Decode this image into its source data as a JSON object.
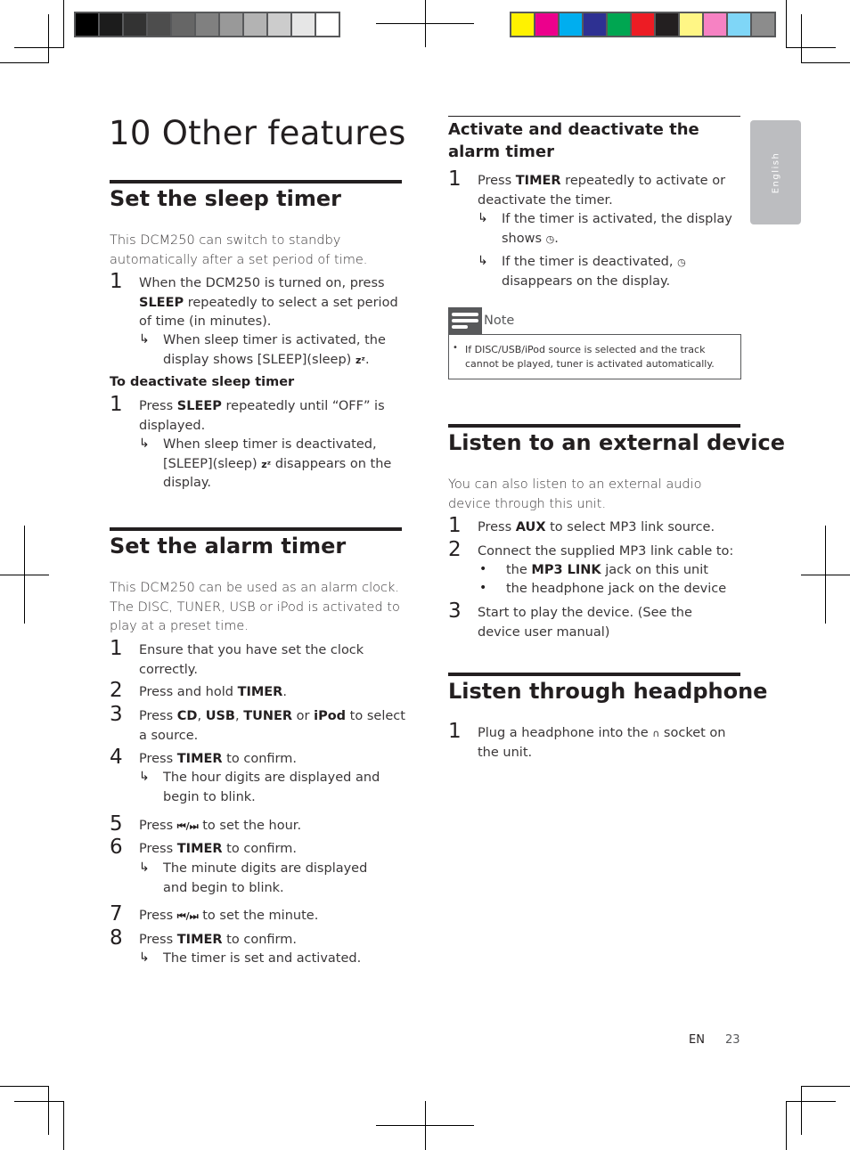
{
  "color_bars": {
    "grayscale": [
      "#000000",
      "#1c1c1c",
      "#333333",
      "#4d4d4d",
      "#666666",
      "#808080",
      "#999999",
      "#b3b3b3",
      "#cccccc",
      "#e6e6e6",
      "#ffffff"
    ],
    "process": [
      "#fff200",
      "#ec008c",
      "#00aeef",
      "#2e3192",
      "#00a651",
      "#ed1c24",
      "#231f20",
      "#fff685",
      "#f682c3",
      "#7fd6f7",
      "#8c8c8c"
    ]
  },
  "language_tab": "English",
  "page_title": "10 Other features",
  "sleep": {
    "heading": "Set the sleep timer",
    "intro": "This DCM250 can switch to standby automatically after a set period of time.",
    "step1": {
      "num": "1",
      "a": "When the DCM250 is turned on, press ",
      "b": "SLEEP",
      "c": " repeatedly to select a set period of time (in minutes)."
    },
    "result1": "When sleep timer is activated, the display shows [SLEEP](sleep) ",
    "sleep_symbol": "zᶻ",
    "result1_end": ".",
    "deactivate_heading": "To deactivate sleep timer",
    "dstep1": {
      "num": "1",
      "a": "Press ",
      "b": "SLEEP",
      "c": " repeatedly until “OFF” is displayed."
    },
    "dresult1_a": "When sleep timer is deactivated, [SLEEP](sleep) ",
    "dresult1_b": " disappears on the display."
  },
  "alarm": {
    "heading": "Set the alarm timer",
    "intro": "This DCM250 can be used as an alarm clock. The DISC, TUNER, USB or iPod is activated to play at a preset time.",
    "steps": [
      {
        "num": "1",
        "text": "Ensure that you have set the clock correctly."
      },
      {
        "num": "2",
        "a": "Press and hold ",
        "b": "TIMER",
        "c": "."
      },
      {
        "num": "3",
        "a": "Press ",
        "b1": "CD",
        "s1": ", ",
        "b2": "USB",
        "s2": ", ",
        "b3": "TUNER",
        "s3": " or ",
        "b4": "iPod",
        "c": " to select a source."
      },
      {
        "num": "4",
        "a": "Press ",
        "b": "TIMER",
        "c": " to confirm.",
        "result": "The hour digits are displayed and begin to blink."
      },
      {
        "num": "5",
        "a": "Press ",
        "icon": "⏮/⏭",
        "c": " to set the hour."
      },
      {
        "num": "6",
        "a": "Press ",
        "b": "TIMER",
        "c": " to confirm.",
        "result": "The minute digits are displayed and begin to blink."
      },
      {
        "num": "7",
        "a": "Press ",
        "icon": "⏮/⏭",
        "c": " to set the minute."
      },
      {
        "num": "8",
        "a": "Press ",
        "b": "TIMER",
        "c": " to confirm.",
        "result": "The timer is set and activated."
      }
    ]
  },
  "activate": {
    "heading": "Activate and deactivate the alarm timer",
    "step1": {
      "num": "1",
      "a": "Press ",
      "b": "TIMER",
      "c": " repeatedly to activate or deactivate the timer."
    },
    "result1": "If the timer is activated, the display shows ",
    "result2_a": "If the timer is deactivated, ",
    "result2_b": "disappears on the display.",
    "timer_symbol": "◷"
  },
  "note": {
    "label": "Note",
    "text": "If DISC/USB/iPod source is selected and the track cannot be played, tuner is activated automatically."
  },
  "external": {
    "heading": "Listen to an external device",
    "intro": "You can also listen to an external audio device through this unit.",
    "step1": {
      "num": "1",
      "a": "Press ",
      "b": "AUX",
      "c": " to select MP3 link source."
    },
    "step2": {
      "num": "2",
      "text": "Connect the supplied MP3 link cable to:"
    },
    "bullet1": {
      "a": "the ",
      "b": "MP3 LINK",
      "c": " jack on this unit"
    },
    "bullet2": "the headphone jack on the device",
    "step3": {
      "num": "3",
      "text": "Start to play the device. (See the device user manual)"
    }
  },
  "headphone": {
    "heading": "Listen through headphone",
    "step1": {
      "num": "1",
      "a": "Plug a headphone into the ",
      "icon": "🎧",
      "c": " socket on the unit."
    }
  },
  "footer": {
    "lang": "EN",
    "page": "23"
  }
}
